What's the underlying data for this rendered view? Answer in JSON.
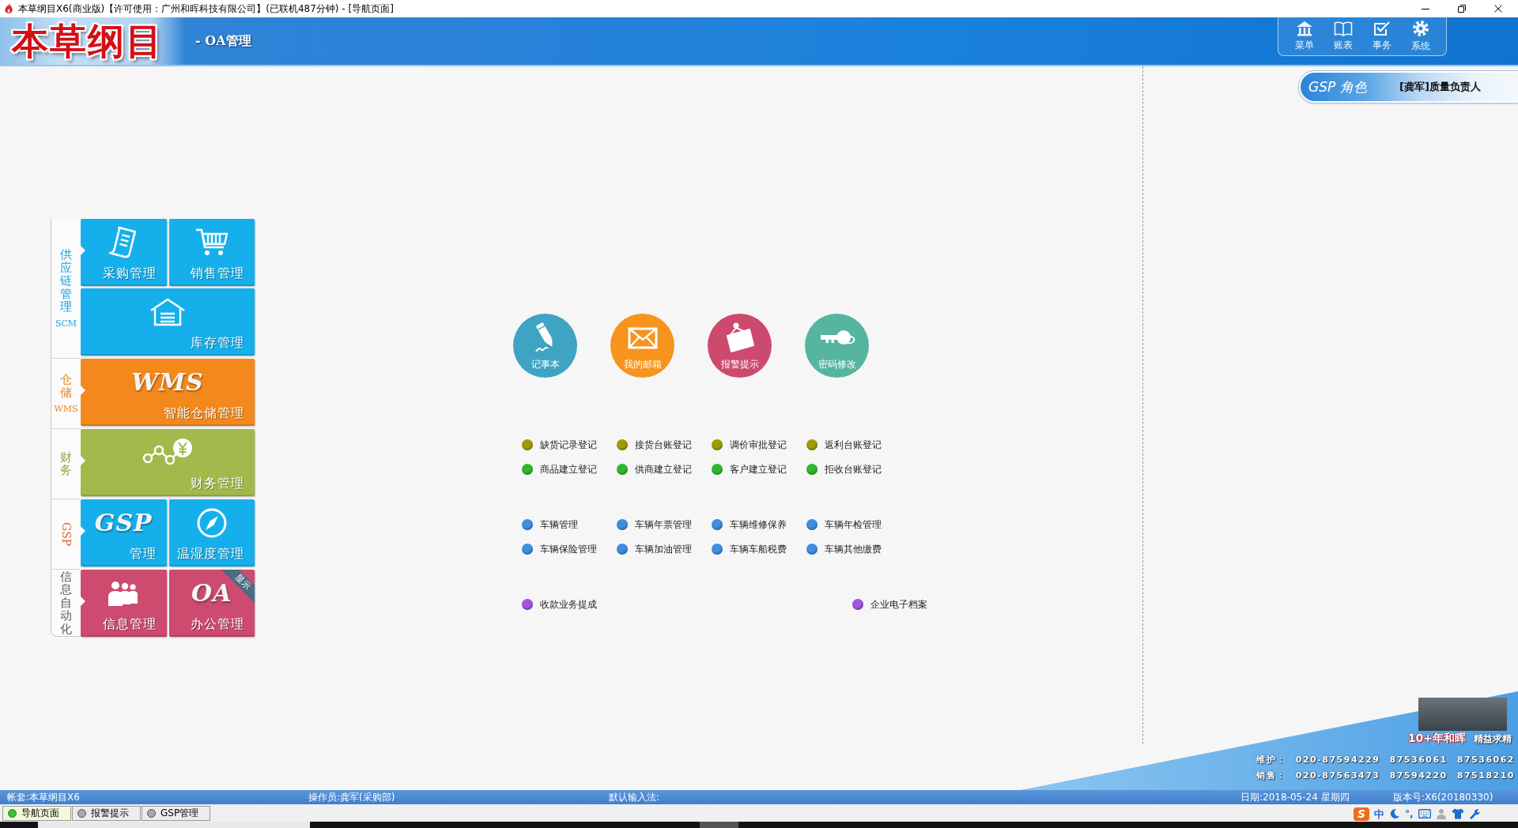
{
  "window": {
    "title": "本草纲目X6(商业版)【许可使用：广州和晖科技有限公司】(已联机487分钟) - [导航页面]"
  },
  "header": {
    "logo": "本草纲目",
    "subtitle": "- OA管理",
    "nav": [
      {
        "label": "菜单",
        "kind": "home"
      },
      {
        "label": "账表",
        "kind": "book"
      },
      {
        "label": "事务",
        "kind": "task"
      },
      {
        "label": "系统",
        "kind": "gear"
      }
    ]
  },
  "gsp_role": {
    "label": "GSP 角色",
    "value": "[龚军]质量负责人"
  },
  "modules": [
    {
      "label": "供应链管理",
      "code": "SCM",
      "kind": "stacked",
      "color": "#1ba1e2",
      "tiles": [
        {
          "label": "采购管理",
          "kind": "document",
          "color": "#15b0ec"
        },
        {
          "label": "销售管理",
          "kind": "cart",
          "color": "#15b0ec"
        },
        {
          "label": "库存管理",
          "kind": "warehouse",
          "color": "#15b0ec"
        }
      ]
    },
    {
      "label": "仓储",
      "code": "WMS",
      "kind": "stacked",
      "color": "#f0831e",
      "tiles": [
        {
          "label": "智能仓储管理",
          "kind": "logo",
          "logo": "WMS",
          "color": "#f3891c"
        }
      ]
    },
    {
      "label": "财务",
      "kind": "stacked",
      "color": "#8aab3c",
      "tiles": [
        {
          "label": "财务管理",
          "kind": "chart",
          "color": "#a2ba4c"
        }
      ]
    },
    {
      "label": "GSP",
      "kind": "rotated",
      "color": "#e0663a",
      "tiles": [
        {
          "label": "管理",
          "kind": "logo",
          "logo": "GSP",
          "color": "#15b0ec"
        },
        {
          "label": "温湿度管理",
          "kind": "compass",
          "color": "#15b0ec"
        }
      ]
    },
    {
      "label": "信息自动化",
      "kind": "stacked",
      "color": "#555b66",
      "tiles": [
        {
          "label": "信息管理",
          "kind": "people",
          "color": "#cc4b6f"
        },
        {
          "label": "办公管理",
          "kind": "logo",
          "logo": "OA",
          "badge": "显示",
          "color": "#cc4b6f"
        }
      ]
    }
  ],
  "quick_actions": [
    {
      "label": "记事本",
      "kind": "pencil",
      "color": "#3fa3c4"
    },
    {
      "label": "我的邮箱",
      "kind": "envelope",
      "color": "#f7941d"
    },
    {
      "label": "报警提示",
      "kind": "sign",
      "color": "#cc4a6e"
    },
    {
      "label": "密码修改",
      "kind": "key",
      "color": "#56b59e"
    }
  ],
  "link_sections": [
    {
      "items": [
        {
          "label": "缺货记录登记",
          "color": "#a09c00"
        },
        {
          "label": "接货台账登记",
          "color": "#a09c00"
        },
        {
          "label": "调价审批登记",
          "color": "#a09c00"
        },
        {
          "label": "返利台账登记",
          "color": "#a09c00"
        },
        {
          "label": "商品建立登记",
          "color": "#2eb82e"
        },
        {
          "label": "供商建立登记",
          "color": "#2eb82e"
        },
        {
          "label": "客户建立登记",
          "color": "#2eb82e"
        },
        {
          "label": "拒收台账登记",
          "color": "#2eb82e"
        }
      ]
    },
    {
      "items": [
        {
          "label": "车辆管理",
          "color": "#3d8fe0"
        },
        {
          "label": "车辆年票管理",
          "color": "#3d8fe0"
        },
        {
          "label": "车辆维修保养",
          "color": "#3d8fe0"
        },
        {
          "label": "车辆年检管理",
          "color": "#3d8fe0"
        },
        {
          "label": "车辆保险管理",
          "color": "#3d8fe0"
        },
        {
          "label": "车辆加油管理",
          "color": "#3d8fe0"
        },
        {
          "label": "车辆车船税费",
          "color": "#3d8fe0"
        },
        {
          "label": "车辆其他缴费",
          "color": "#3d8fe0"
        }
      ]
    },
    {
      "items": [
        {
          "label": "收款业务提成",
          "color": "#a255e0"
        },
        {
          "label": "企业电子档案",
          "color": "#a255e0"
        }
      ]
    }
  ],
  "footer_banner": {
    "slogan": "10+年和晖",
    "motto": "精益求精",
    "contacts": [
      {
        "label": "维护：",
        "numbers": [
          "020-87594229",
          "87536061",
          "87536062"
        ]
      },
      {
        "label": "销售：",
        "numbers": [
          "020-87563473",
          "87594220",
          "87518210"
        ]
      }
    ]
  },
  "status_bar": {
    "fields": [
      "帐套:本草纲目X6",
      "操作员:龚军(采购部)",
      "默认输入法:",
      "日期:2018-05-24 星期四",
      "版本号:X6(20180330)"
    ]
  },
  "tabs": [
    {
      "label": "导航页面",
      "selected": true
    },
    {
      "label": "报警提示",
      "selected": false
    },
    {
      "label": "GSP管理",
      "selected": false
    }
  ],
  "ime_toolbar": {
    "logo": "S",
    "mode": "中",
    "punctuation": "°,"
  }
}
